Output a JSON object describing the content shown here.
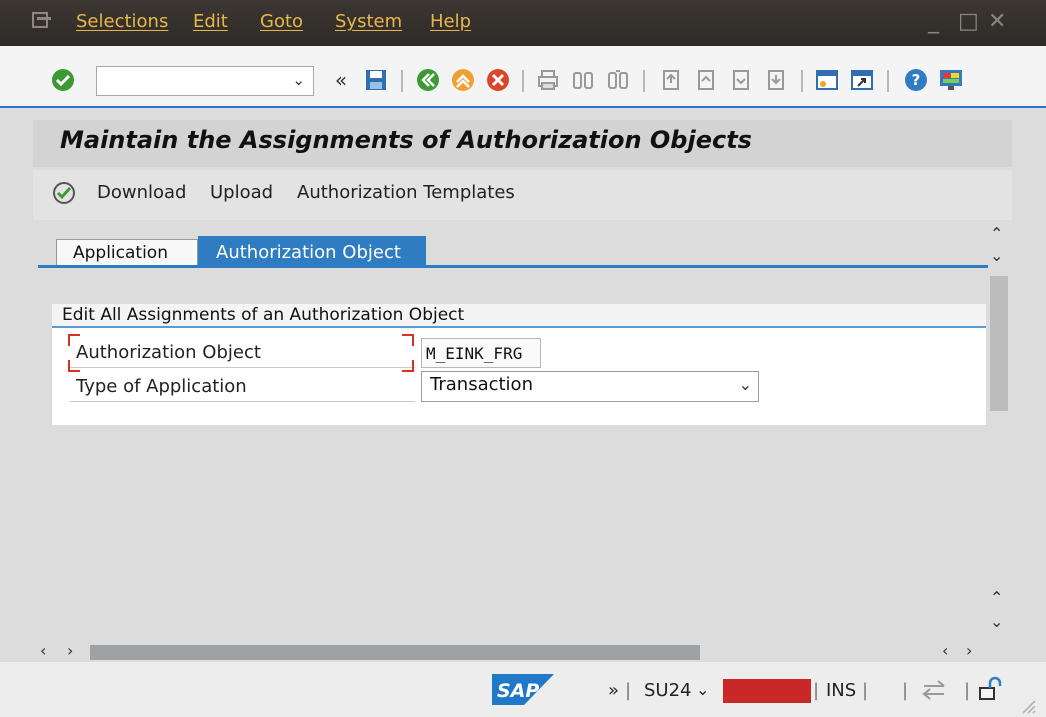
{
  "menu": {
    "items": [
      "Selections",
      "Edit",
      "Goto",
      "System",
      "Help"
    ]
  },
  "window_controls": {
    "minimize": "_",
    "maximize": "□",
    "close": "✕"
  },
  "toolbar": {
    "command_field_value": "",
    "icons": [
      "enter-icon",
      "back-double-icon",
      "save-icon",
      "back-icon",
      "exit-icon",
      "cancel-icon",
      "print-icon",
      "find-icon",
      "find-next-icon",
      "first-page-icon",
      "previous-page-icon",
      "next-page-icon",
      "last-page-icon",
      "create-session-icon",
      "shortcut-icon",
      "help-icon",
      "customize-layout-icon"
    ]
  },
  "header": {
    "title": "Maintain the Assignments of Authorization Objects"
  },
  "app_toolbar": {
    "download": "Download",
    "upload": "Upload",
    "templates": "Authorization Templates"
  },
  "tabs": [
    {
      "label": "Application",
      "active": false
    },
    {
      "label": "Authorization Object",
      "active": true
    }
  ],
  "group": {
    "title": "Edit All Assignments of an Authorization Object",
    "fields": {
      "auth_object_label": "Authorization Object",
      "auth_object_value": "M_EINK_FRG",
      "type_label": "Type of Application",
      "type_value": "Transaction"
    }
  },
  "statusbar": {
    "logo_text": "SAP",
    "chevron": "»",
    "transaction": "SU24",
    "mode": "INS"
  },
  "colors": {
    "accent": "#2f7cc3",
    "menu_text": "#e8b64a",
    "redaction": "#c82828"
  }
}
